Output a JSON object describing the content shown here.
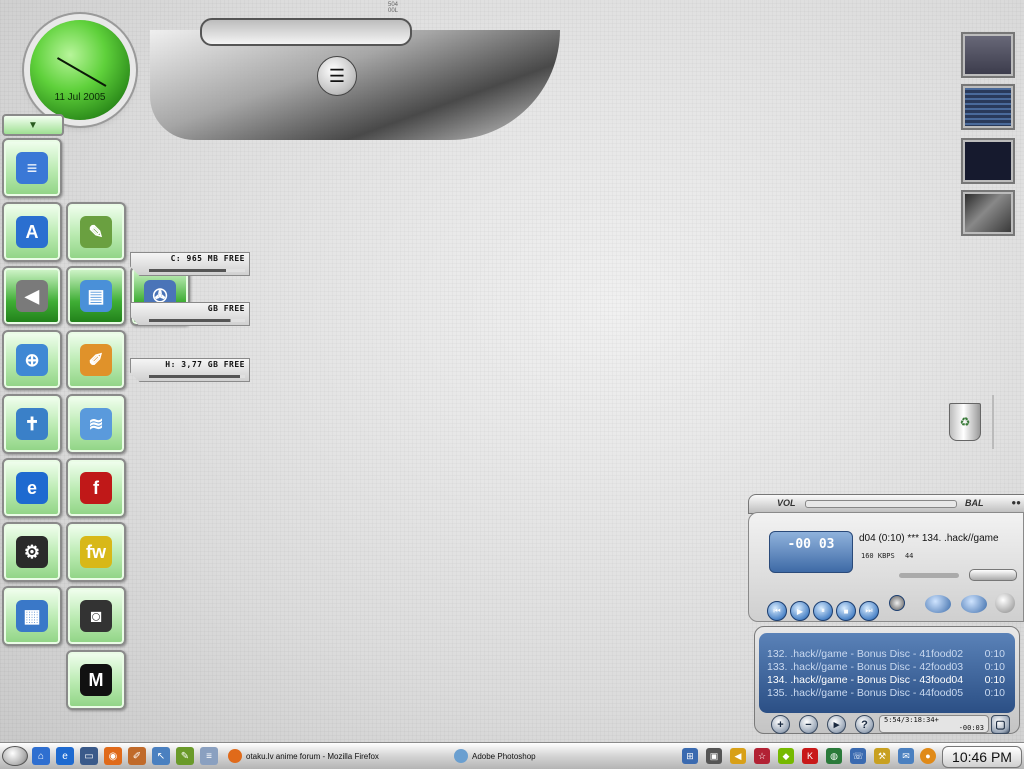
{
  "top_chrome": {
    "clock_date": "11 Jul 2005",
    "mini_label_1": "504",
    "mini_label_2": "00L"
  },
  "dock": {
    "handle_icon": "chevron-down-icon",
    "tiles": [
      {
        "name": "notepad",
        "icon": "notepad-icon",
        "color": "#3a78d6",
        "glyph": "≡"
      },
      {
        "name": "app-blue-a",
        "icon": "app-a-icon",
        "color": "#2a6fd0",
        "glyph": "A"
      },
      {
        "name": "pen-tool",
        "icon": "pen-icon",
        "color": "#6aa040",
        "glyph": "✎"
      },
      {
        "name": "back-arrow",
        "icon": "arrow-left-icon",
        "color": "#7a7a7a",
        "glyph": "◀"
      },
      {
        "name": "drive-manager",
        "icon": "hard-drive-icon",
        "color": "#4a90d8",
        "glyph": "▤"
      },
      {
        "name": "fan-disc",
        "icon": "fan-icon",
        "color": "#4a74b8",
        "glyph": "✇"
      },
      {
        "name": "network",
        "icon": "globe-icon",
        "color": "#3f88d4",
        "glyph": "⊕"
      },
      {
        "name": "paint",
        "icon": "paint-brush-icon",
        "color": "#e0922a",
        "glyph": "✐"
      },
      {
        "name": "weather",
        "icon": "weather-icon",
        "color": "#3a80c8",
        "glyph": "✝"
      },
      {
        "name": "dreamweaver",
        "icon": "waves-icon",
        "color": "#5a9adc",
        "glyph": "≋"
      },
      {
        "name": "internet-explorer",
        "icon": "ie-icon",
        "color": "#1e6ad0",
        "glyph": "e"
      },
      {
        "name": "flash",
        "icon": "flash-icon",
        "color": "#c01818",
        "glyph": "f"
      },
      {
        "name": "settings",
        "icon": "gear-icon",
        "color": "#2a2a2a",
        "glyph": "⚙"
      },
      {
        "name": "fireworks",
        "icon": "fw-icon",
        "color": "#d8b818",
        "glyph": "fw"
      },
      {
        "name": "desktop-window",
        "icon": "window-icon",
        "color": "#3a78c8",
        "glyph": "▦"
      },
      {
        "name": "video-camera",
        "icon": "camera-icon",
        "color": "#333333",
        "glyph": "◙"
      },
      {
        "name": "maya",
        "icon": "maya-icon",
        "color": "#111111",
        "glyph": "M"
      }
    ]
  },
  "drives": [
    {
      "label": "C: 965 MB FREE",
      "fill": 0.8
    },
    {
      "label": "GB FREE",
      "fill": 0.85
    },
    {
      "label": "H: 3,77 GB FREE",
      "fill": 0.95
    }
  ],
  "winamp": {
    "vol_label": "VOL",
    "bal_label": "BAL",
    "time_display": "-00 03",
    "track_scroll": "d04 (0:10)  ***  134. .hack//game",
    "kbps": "160",
    "kbps_unit": "KBPS",
    "khz": "44",
    "playlist": [
      {
        "title": "132. .hack//game - Bonus Disc - 41food02",
        "time": "0:10",
        "current": false
      },
      {
        "title": "133. .hack//game - Bonus Disc - 42food03",
        "time": "0:10",
        "current": false
      },
      {
        "title": "134. .hack//game - Bonus Disc - 43food04",
        "time": "0:10",
        "current": true
      },
      {
        "title": "135. .hack//game - Bonus Disc - 44food05",
        "time": "0:10",
        "current": false
      }
    ],
    "playlist_info": "5:54/3:18:34+",
    "playlist_remaining": "-00:03"
  },
  "taskbar": {
    "tasks": [
      {
        "label": "otaku.lv anime forum - Mozilla Firefox",
        "icon": "firefox-icon",
        "color": "#e06a1a"
      },
      {
        "label": "Adobe Photoshop",
        "icon": "photoshop-icon",
        "color": "#6a9fd0"
      }
    ],
    "clock": "10:46 PM"
  }
}
